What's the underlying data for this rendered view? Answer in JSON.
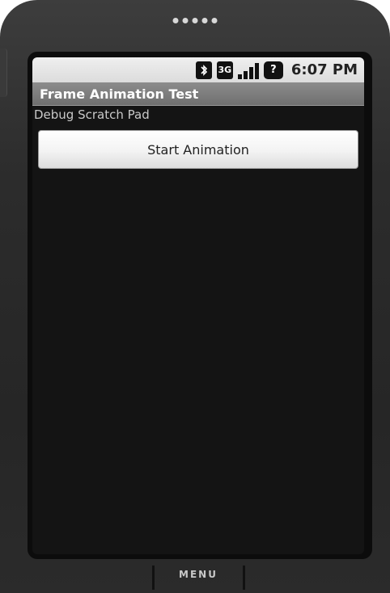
{
  "status_bar": {
    "bluetooth_icon": "bluetooth-icon",
    "network_badge": "3G",
    "signal_icon": "signal-strength-icon",
    "battery_icon": "battery-unknown-icon",
    "battery_symbol": "?",
    "time": "6:07 PM"
  },
  "app": {
    "title": "Frame Animation Test",
    "debug_label": "Debug Scratch Pad",
    "start_button_label": "Start Animation"
  },
  "hardware": {
    "menu_label": "MENU"
  }
}
